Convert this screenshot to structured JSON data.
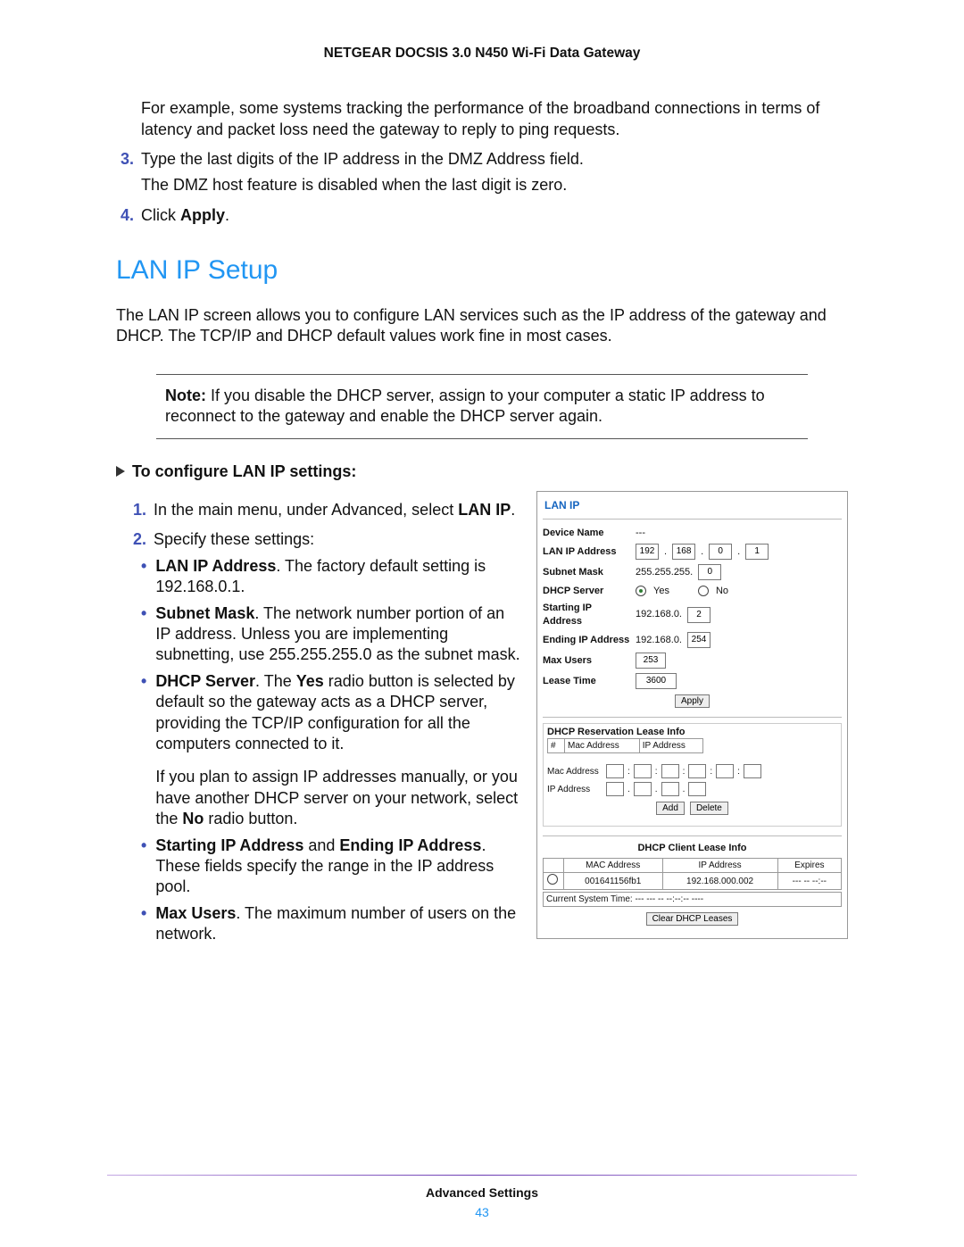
{
  "header": {
    "title": "NETGEAR DOCSIS 3.0 N450 Wi-Fi Data Gateway"
  },
  "intro": {
    "example": "For example, some systems tracking the performance of the broadband connections in terms of latency and packet loss need the gateway to reply to ping requests.",
    "step3_num": "3.",
    "step3_text": "Type the last digits of the IP address in the DMZ Address field.",
    "step3_follow": "The DMZ host feature is disabled when the last digit is zero.",
    "step4_num": "4.",
    "step4_pre": "Click ",
    "step4_bold": "Apply",
    "step4_post": "."
  },
  "h2": "LAN IP Setup",
  "lanip_desc": "The LAN IP screen allows you to configure LAN services such as the IP address of the gateway and DHCP. The TCP/IP and DHCP default values work fine in most cases.",
  "note": {
    "label": "Note:",
    "text": " If you disable the DHCP server, assign to your computer a static IP address to reconnect to the gateway and enable the DHCP server again."
  },
  "task_head": "To configure LAN IP settings:",
  "steps": {
    "s1_num": "1.",
    "s1_pre": "In the main menu, under Advanced, select ",
    "s1_bold": "LAN IP",
    "s1_post": ".",
    "s2_num": "2.",
    "s2_text": "Specify these settings:"
  },
  "bullets": {
    "b1_bold": "LAN IP Address",
    "b1_text": ". The factory default setting is 192.168.0.1.",
    "b2_bold": "Subnet Mask",
    "b2_text": ". The network number portion of an IP address. Unless you are implementing subnetting, use 255.255.255.0 as the subnet mask.",
    "b3_bold": "DHCP Server",
    "b3_mid1": ". The ",
    "b3_bold2": "Yes",
    "b3_mid2": " radio button is selected by default so the gateway acts as a DHCP server, providing the TCP/IP configuration for all the computers connected to it.",
    "b3_para2a": "If you plan to assign IP addresses manually, or you have another DHCP server on your network, select the ",
    "b3_para2_bold": "No",
    "b3_para2b": " radio button.",
    "b4_bold1": "Starting IP Address",
    "b4_mid": " and ",
    "b4_bold2": "Ending IP Address",
    "b4_text": ". These fields specify the range in the IP address pool.",
    "b5_bold": "Max Users",
    "b5_text": ". The maximum number of users on the network."
  },
  "panel": {
    "title": "LAN IP",
    "device_name_label": "Device Name",
    "device_name_value": "---",
    "lan_ip_label": "LAN IP Address",
    "ip": {
      "o1": "192",
      "o2": "168",
      "o3": "0",
      "o4": "1"
    },
    "subnet_label": "Subnet Mask",
    "subnet_prefix": "255.255.255.",
    "subnet_last": "0",
    "dhcp_label": "DHCP Server",
    "yes": "Yes",
    "no": "No",
    "start_ip_label": "Starting IP Address",
    "start_ip_prefix": "192.168.0.",
    "start_ip_last": "2",
    "end_ip_label": "Ending IP Address",
    "end_ip_prefix": "192.168.0.",
    "end_ip_last": "254",
    "max_users_label": "Max Users",
    "max_users_value": "253",
    "lease_time_label": "Lease Time",
    "lease_time_value": "3600",
    "apply": "Apply",
    "reservation_title": "DHCP Reservation Lease Info",
    "col_hash": "#",
    "col_mac": "Mac Address",
    "col_ip": "IP Address",
    "mac_label": "Mac Address",
    "ip_label": "IP Address",
    "add": "Add",
    "delete": "Delete",
    "client_title": "DHCP Client Lease Info",
    "client_cols": {
      "mac": "MAC Address",
      "ip": "IP Address",
      "exp": "Expires"
    },
    "client_row": {
      "mac": "001641156fb1",
      "ip": "192.168.000.002",
      "exp": "--- -- --:--"
    },
    "systime": "Current System Time: --- --- -- --:--:-- ----",
    "clear": "Clear DHCP Leases"
  },
  "footer": {
    "section": "Advanced Settings",
    "page": "43"
  }
}
